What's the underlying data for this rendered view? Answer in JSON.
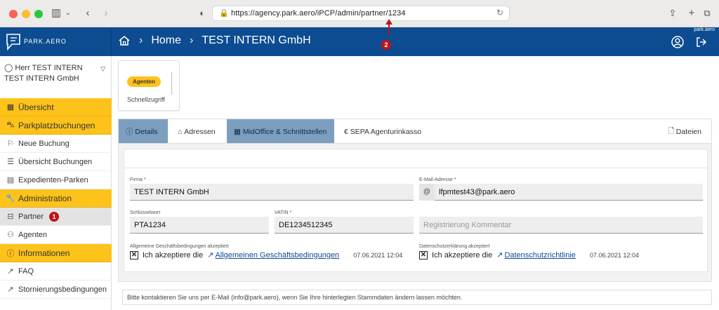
{
  "browser": {
    "url": "https://agency.park.aero/iPCP/admin/partner/1234"
  },
  "app": {
    "logo_text": "PARK.AERO",
    "brand_tag": "park.aero",
    "breadcrumb": [
      "Home",
      "TEST INTERN GmbH"
    ]
  },
  "annotations": {
    "badge_url": "2",
    "badge_partner": "1"
  },
  "sidebar": {
    "user_line1": "Herr TEST INTERN",
    "user_line2": "TEST INTERN GmbH",
    "items": [
      {
        "label": "Übersicht",
        "type": "header",
        "icon": "table-icon"
      },
      {
        "label": "Parkplatzbuchungen",
        "type": "header",
        "icon": "car-icon"
      },
      {
        "label": "Neue Buchung",
        "type": "link",
        "icon": "flag-icon"
      },
      {
        "label": "Übersicht Buchungen",
        "type": "link",
        "icon": "list-icon"
      },
      {
        "label": "Expedienten-Parken",
        "type": "link",
        "icon": "document-icon"
      },
      {
        "label": "Administration",
        "type": "header",
        "icon": "wrench-icon"
      },
      {
        "label": "Partner",
        "type": "link",
        "icon": "briefcase-icon"
      },
      {
        "label": "Agenten",
        "type": "link",
        "icon": "users-icon"
      },
      {
        "label": "Informationen",
        "type": "header",
        "icon": "info-icon"
      },
      {
        "label": "FAQ",
        "type": "link",
        "icon": "external-link-icon"
      },
      {
        "label": "Stornierungsbedingungen",
        "type": "link",
        "icon": "external-link-icon"
      }
    ]
  },
  "quick_access": {
    "pill": "Agenten",
    "label": "Schnellzugriff"
  },
  "tabs": [
    {
      "label": "Details",
      "icon": "info-icon"
    },
    {
      "label": "Adressen",
      "icon": "home-icon"
    },
    {
      "label": "MidOffice & Schnittstellen",
      "icon": "table-icon"
    },
    {
      "label": "SEPA Agenturinkasso",
      "icon": "euro-icon"
    },
    {
      "label": "Dateien",
      "icon": "file-icon"
    }
  ],
  "form": {
    "firma_label": "Firma *",
    "firma_value": "TEST INTERN GmbH",
    "email_label": "E-Mail-Adresse *",
    "email_value": "lfpmtest43@park.aero",
    "keyword_label": "Schlüsselwort",
    "keyword_value": "PTA1234",
    "vatin_label": "VATIN *",
    "vatin_value": "DE1234512345",
    "comment_placeholder": "Registrierung Kommentar",
    "agb_label": "Allgemeine Geschäftsbedingungen akzeptiert",
    "agb_text": "Ich akzeptiere die",
    "agb_link": "Allgemeinen Geschäftsbedingungen",
    "agb_time": "07.06.2021 12:04",
    "privacy_label": "Datenschutzerklärung akzeptiert",
    "privacy_text": "Ich akzeptiere die",
    "privacy_link": "Datenschutzrichtlinie",
    "privacy_time": "07.06.2021 12:04"
  },
  "footer_note": "Bitte kontaktieren Sie uns per E-Mail (info@park.aero), wenn Sie Ihre hinterlegten Stammdaten ändern lassen möchten."
}
